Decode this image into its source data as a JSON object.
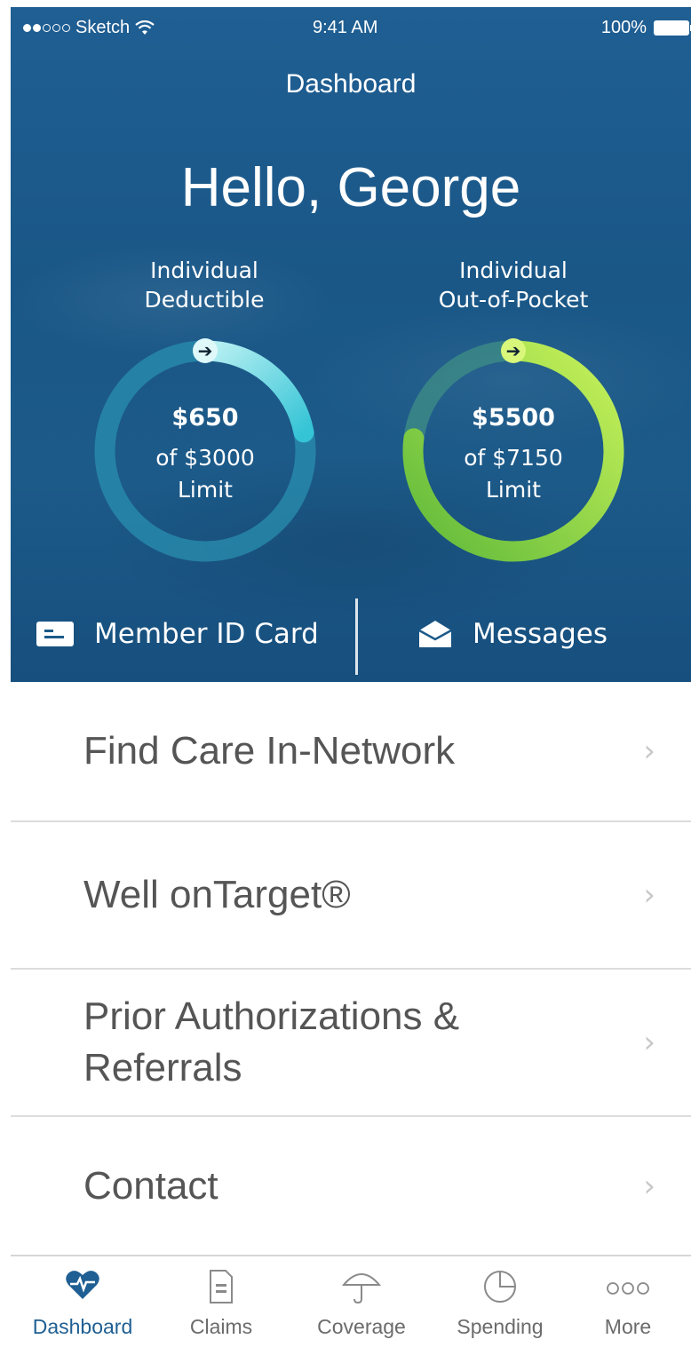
{
  "status_bar": {
    "carrier": "Sketch",
    "time": "9:41 AM",
    "battery": "100%"
  },
  "header": {
    "title": "Dashboard",
    "greeting": "Hello, George"
  },
  "gauges": [
    {
      "label_line1": "Individual",
      "label_line2": "Deductible",
      "amount": "$650",
      "of_text": "of $3000",
      "limit_text": "Limit",
      "fraction": 0.22,
      "track_color": "#2a8fb0",
      "fill_color_start": "#b8f0f2",
      "fill_color_end": "#35c4d6"
    },
    {
      "label_line1": "Individual",
      "label_line2": "Out-of-Pocket",
      "amount": "$5500",
      "of_text": "of $7150",
      "limit_text": "Limit",
      "fraction": 0.77,
      "track_color": "#3f8f86",
      "fill_color_start": "#c8f25a",
      "fill_color_end": "#5fb93a"
    }
  ],
  "quick_actions": {
    "member_id": "Member ID Card",
    "messages": "Messages"
  },
  "menu": [
    {
      "label": "Find Care In-Network"
    },
    {
      "label": "Well onTarget®"
    },
    {
      "label": "Prior Authorizations &",
      "label2": "Referrals"
    },
    {
      "label": "Contact"
    }
  ],
  "tabs": [
    {
      "label": "Dashboard",
      "icon": "heart-pulse-icon",
      "active": true
    },
    {
      "label": "Claims",
      "icon": "document-icon",
      "active": false
    },
    {
      "label": "Coverage",
      "icon": "umbrella-icon",
      "active": false
    },
    {
      "label": "Spending",
      "icon": "pie-chart-icon",
      "active": false
    },
    {
      "label": "More",
      "icon": "more-dots-icon",
      "active": false
    }
  ],
  "colors": {
    "brand_blue": "#1f5f93",
    "menu_text": "#555555",
    "chevron": "#c8c8c8"
  }
}
